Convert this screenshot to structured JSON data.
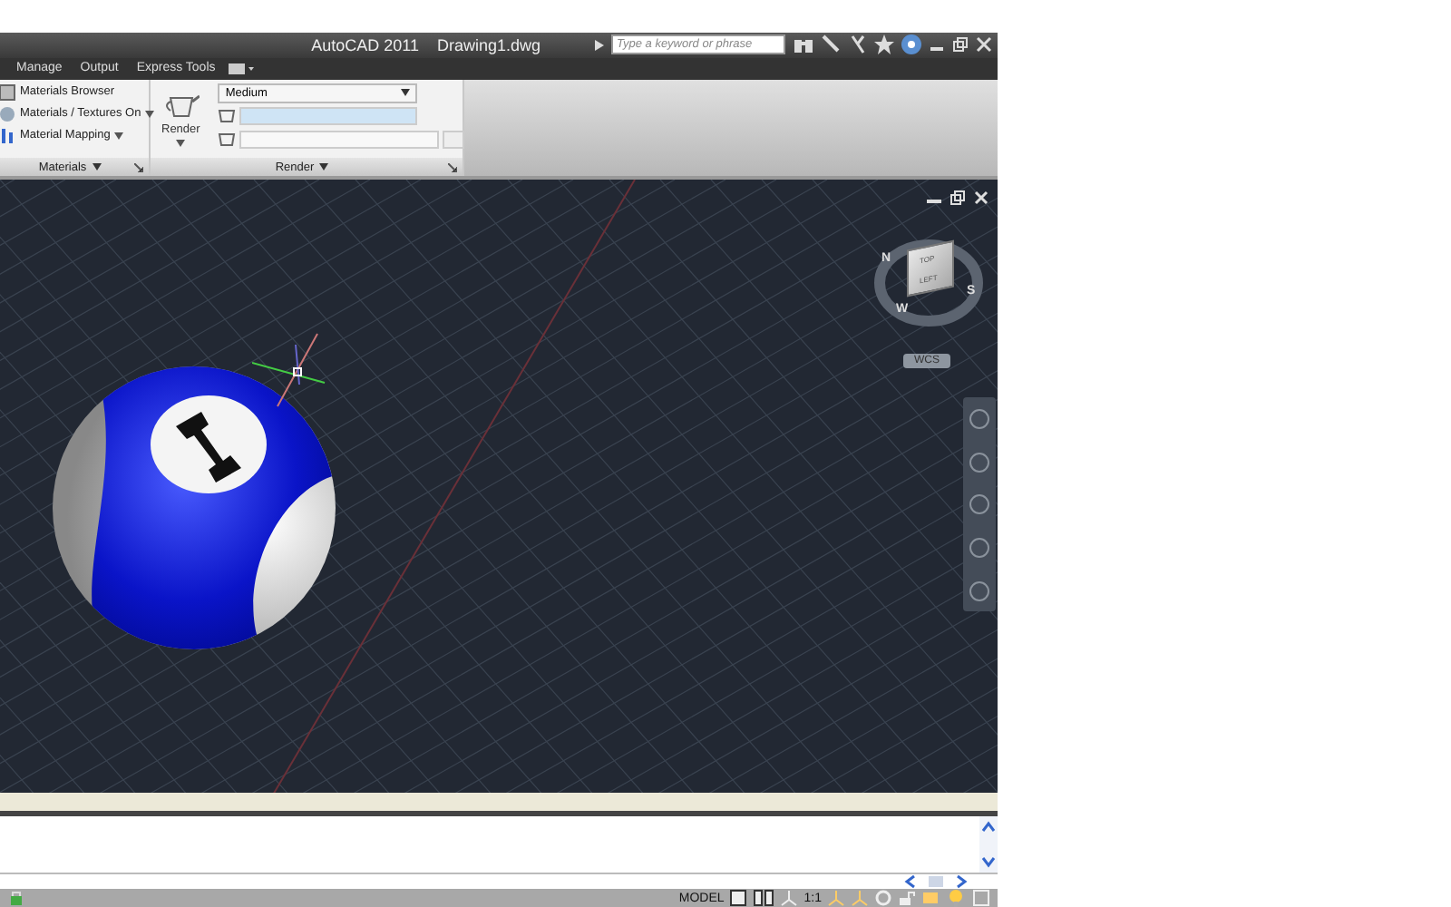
{
  "window": {
    "app_title": "AutoCAD 2011",
    "file_title": "Drawing1.dwg"
  },
  "search": {
    "placeholder": "Type a keyword or phrase"
  },
  "ribbon_tabs": [
    {
      "label": "Manage"
    },
    {
      "label": "Output"
    },
    {
      "label": "Express Tools"
    }
  ],
  "panels": [
    {
      "title": "Materials",
      "items": [
        {
          "label": "Materials Browser",
          "dropdown": false
        },
        {
          "label": "Materials / Textures On",
          "dropdown": true
        },
        {
          "label": "Material Mapping",
          "dropdown": true
        }
      ]
    },
    {
      "title": "Render",
      "button": "Render",
      "quality": "Medium"
    }
  ],
  "viewcube": {
    "top_face": "TOP",
    "side_face": "LEFT",
    "compass": [
      "N",
      "S",
      "W"
    ],
    "ucs": "WCS"
  },
  "status_bar": {
    "space": "MODEL",
    "scale": "1:1"
  }
}
